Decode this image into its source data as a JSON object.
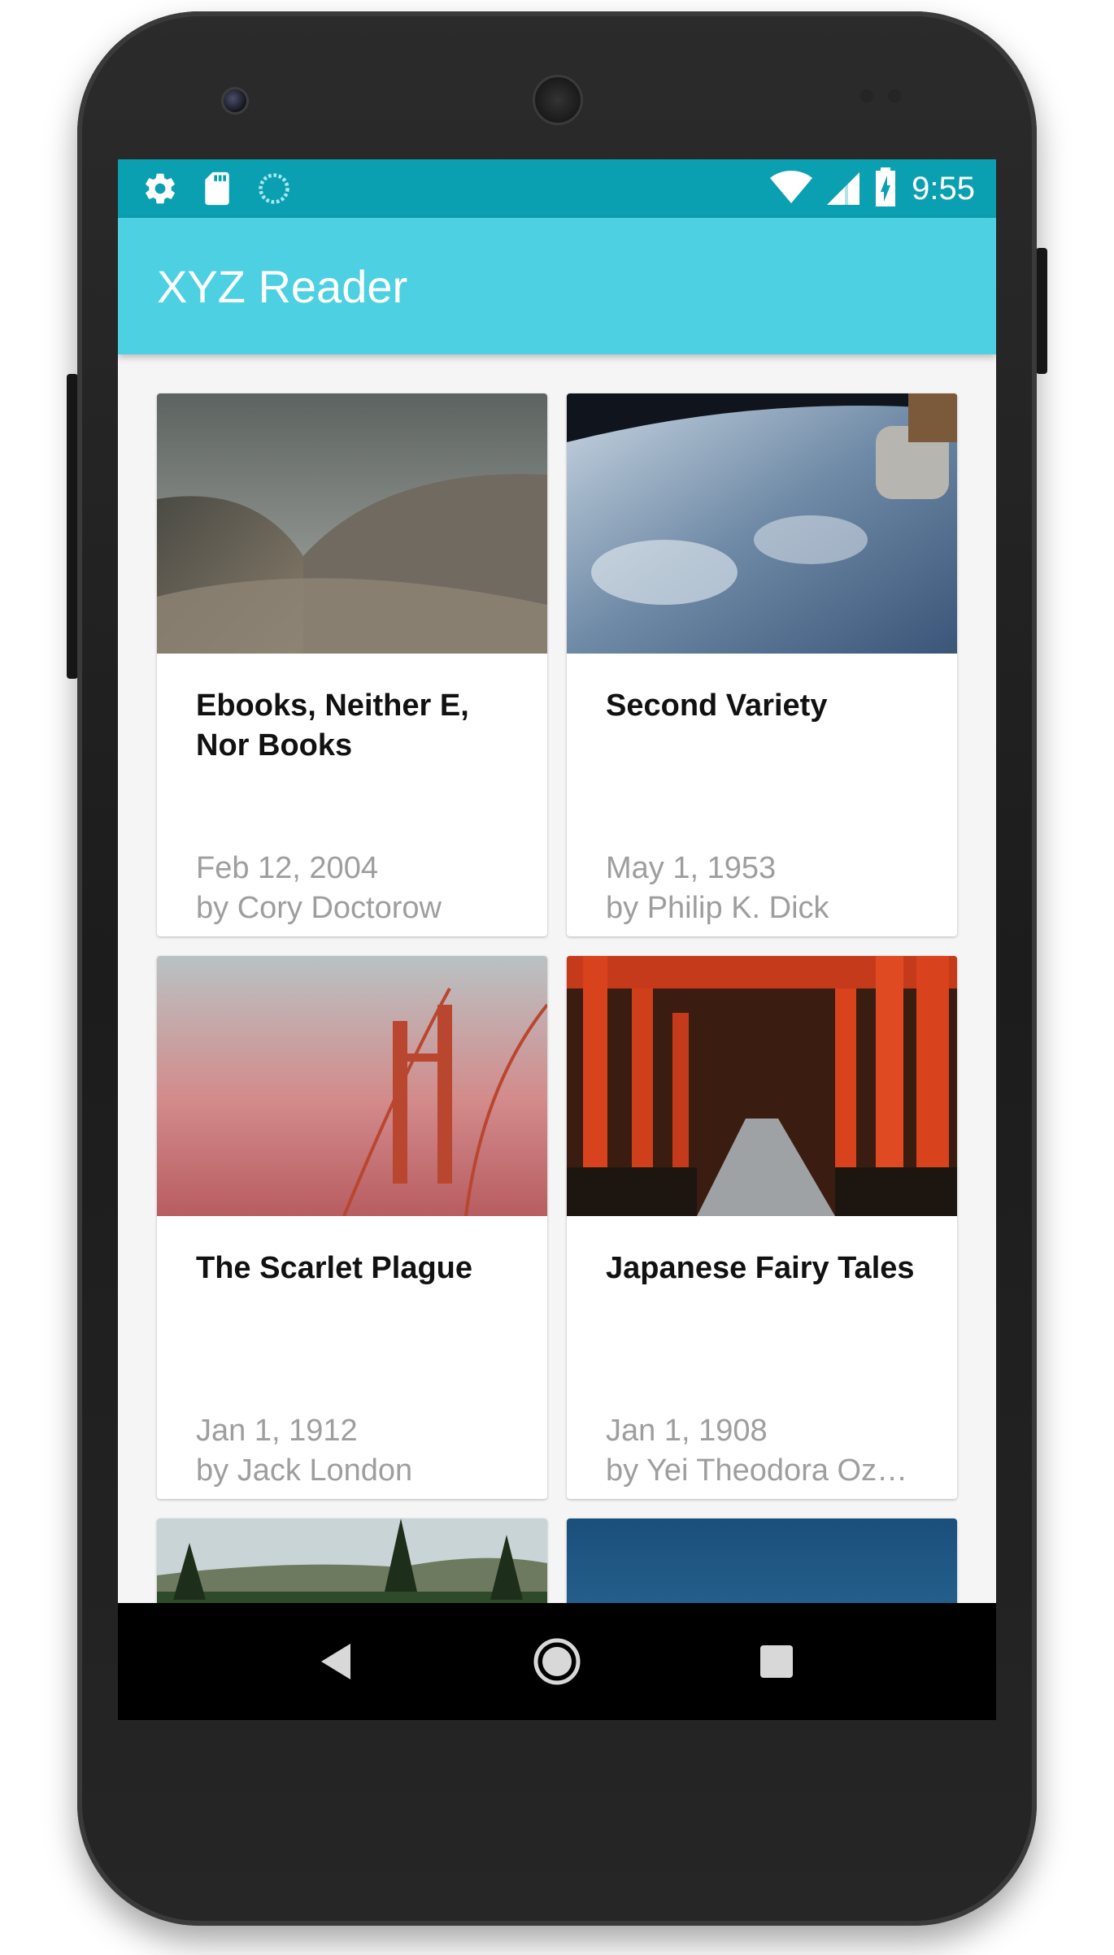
{
  "status_bar": {
    "time": "9:55",
    "background": "#0aa0b2",
    "left_icons": [
      "gear-icon",
      "sd-card-icon",
      "sync-icon"
    ],
    "right_icons": [
      "wifi-icon",
      "cell-signal-icon",
      "battery-charging-icon"
    ]
  },
  "app_bar": {
    "title": "XYZ Reader",
    "background": "#4dd0e1"
  },
  "articles": [
    {
      "title": "Ebooks, Neither E, Nor Books",
      "date": "Feb 12, 2004",
      "author": "by Cory Doctorow",
      "image": "opera-house-roof"
    },
    {
      "title": "Second Variety",
      "date": "May 1, 1953",
      "author": "by Philip K. Dick",
      "image": "earth-from-space"
    },
    {
      "title": "The Scarlet Plague",
      "date": "Jan 1, 1912",
      "author": "by Jack London",
      "image": "bridge-in-red-fog"
    },
    {
      "title": "Japanese Fairy Tales",
      "date": "Jan 1, 1908",
      "author": "by Yei Theodora Oz…",
      "image": "torii-gates-path"
    }
  ],
  "partial_articles": [
    {
      "image": "forest-landscape"
    },
    {
      "image": "blue-sky"
    }
  ],
  "nav_bar": {
    "buttons": [
      "back-icon",
      "home-icon",
      "recents-icon"
    ]
  }
}
